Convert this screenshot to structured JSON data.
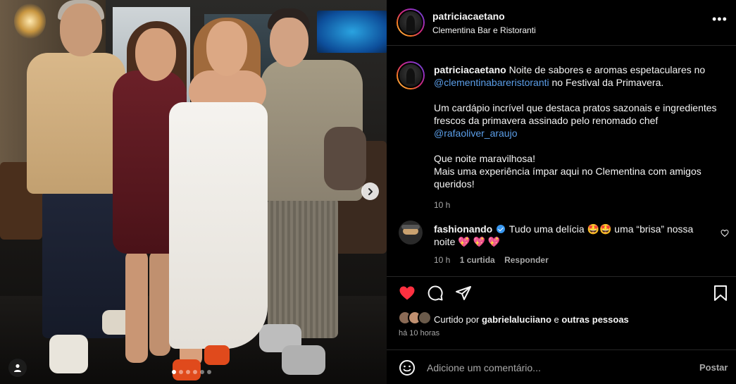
{
  "post": {
    "author": "patriciacaetano",
    "location": "Clementina Bar e Ristoranti",
    "caption": {
      "line1_text": "Noite de sabores e aromas espetaculares no",
      "mention1": "@clementinabareristoranti",
      "line2_text": "no Festival da Primavera.",
      "para2": "Um cardápio incrível que destaca pratos sazonais e ingredientes frescos da primavera assinado pelo renomado chef",
      "mention2": "@rafaoliver_araujo",
      "para3_line1": "Que noite maravilhosa!",
      "para3_line2": "Mais uma experiência ímpar aqui no Clementina com amigos queridos!"
    },
    "caption_time": "10 h",
    "carousel": {
      "slides": 6,
      "active_index": 0
    }
  },
  "comments": [
    {
      "user": "fashionando",
      "verified": true,
      "text_before": "Tudo uma delícia 🤩🤩 uma “brisa” nossa noite",
      "emojis": "💖 💖 💖",
      "time": "10 h",
      "replies": "1 curtida",
      "reply_label": "Responder"
    }
  ],
  "actions": {
    "liked": true,
    "liked_by_prefix": "Curtido por",
    "liked_by_user": "gabrielaluciiano",
    "liked_by_and": "e",
    "liked_by_others": "outras pessoas",
    "posted_ago": "há 10 horas"
  },
  "composer": {
    "placeholder": "Adicione um comentário...",
    "post_label": "Postar"
  },
  "colors": {
    "like_red": "#ff3040",
    "link_blue": "#5b9ee8",
    "verified_blue": "#3797f0",
    "muted": "#a8a8a8"
  },
  "icons": [
    "more-options-icon",
    "heart-icon",
    "comment-icon",
    "share-icon",
    "bookmark-icon",
    "emoji-icon",
    "chevron-right-icon",
    "user-tag-icon",
    "small-heart-icon"
  ]
}
